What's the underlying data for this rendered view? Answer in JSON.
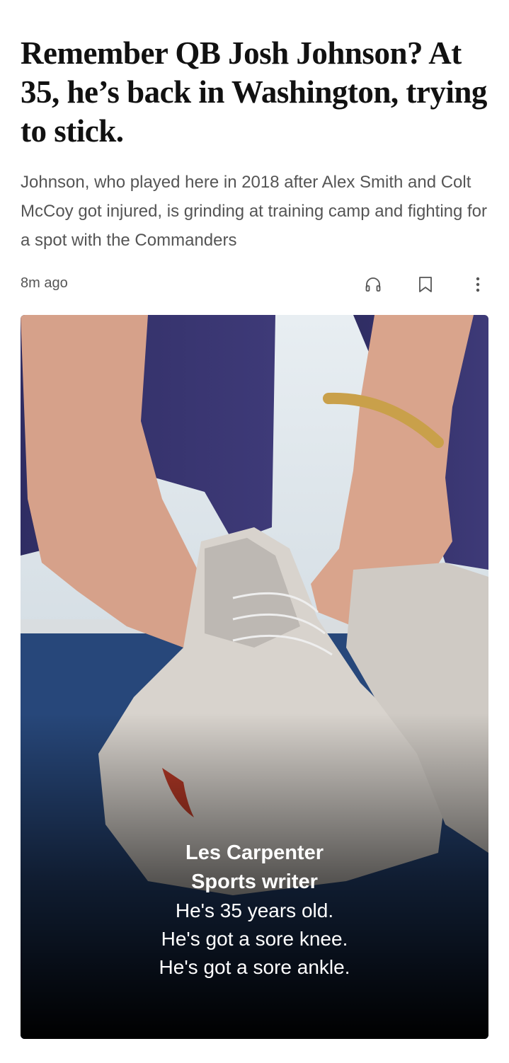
{
  "article": {
    "headline": "Remember QB Josh Johnson? At 35, he’s back in Washington, trying to stick.",
    "dek": "Johnson, who played here in 2018 after Alex Smith and Colt McCoy got injured, is grinding at training camp and fighting for a spot with the Commanders",
    "timestamp": "8m ago"
  },
  "actions": {
    "listen_icon": "headphones-icon",
    "save_icon": "bookmark-icon",
    "more_icon": "more-vertical-icon"
  },
  "video": {
    "speaker_name": "Les Carpenter",
    "speaker_role": "Sports writer",
    "caption_lines": [
      "He's 35 years old.",
      "He's got a sore knee.",
      "He's got a sore ankle."
    ]
  },
  "colors": {
    "headline": "#111111",
    "dek": "#555555",
    "icon": "#555555"
  }
}
